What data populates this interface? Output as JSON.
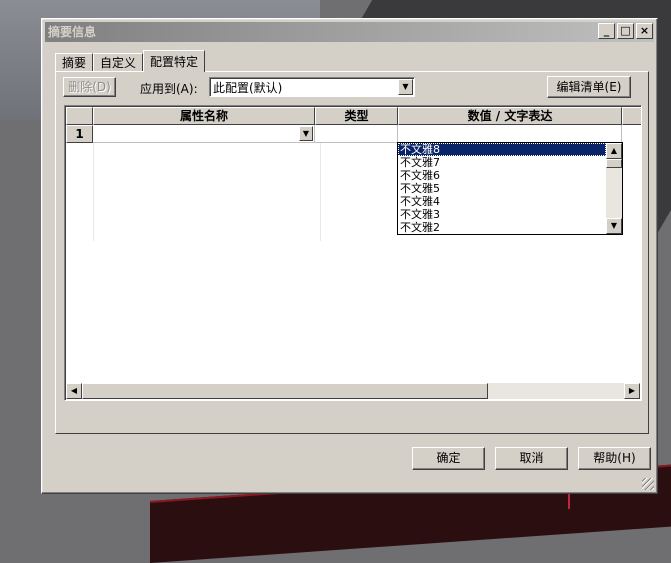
{
  "window": {
    "title": "摘要信息",
    "controls": [
      "_",
      "□",
      "×"
    ]
  },
  "tabs": [
    {
      "label": "摘要",
      "active": false
    },
    {
      "label": "自定义",
      "active": false
    },
    {
      "label": "配置特定",
      "active": true
    }
  ],
  "toolbar": {
    "delete_label": "删除(D)",
    "apply_to_label": "应用到(A):",
    "apply_to_value": "此配置(默认)",
    "edit_list_label": "编辑清单(E)"
  },
  "grid": {
    "columns": [
      "属性名称",
      "类型",
      "数值 / 文字表达"
    ],
    "rows": [
      {
        "number": "1",
        "property": "",
        "type": "",
        "value": ""
      }
    ]
  },
  "dropdown": {
    "items": [
      "不文雅8",
      "不文雅7",
      "不文雅6",
      "不文雅5",
      "不文雅4",
      "不文雅3",
      "不文雅2"
    ],
    "selected": "不文雅8"
  },
  "footer": {
    "ok_label": "确定",
    "cancel_label": "取消",
    "help_label": "帮助(H)"
  },
  "colors": {
    "selection": "#0a246a",
    "dialog_face": "#d4d0c8"
  }
}
